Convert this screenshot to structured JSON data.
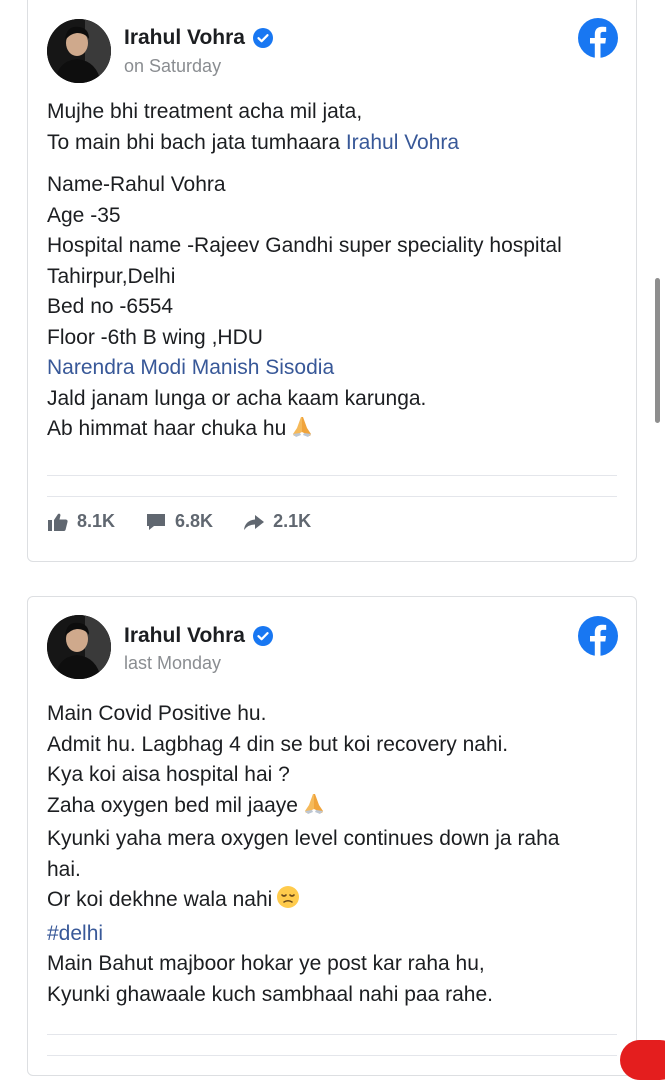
{
  "posts": [
    {
      "author": "Irahul Vohra",
      "timestamp": "on Saturday",
      "lines": {
        "l1": "Mujhe bhi treatment acha mil jata,",
        "l2_text": "To main bhi bach jata tumhaara ",
        "l2_link": "Irahul Vohra",
        "l3": "Name-Rahul Vohra",
        "l4": "Age -35",
        "l5": "Hospital name -Rajeev Gandhi super speciality hospital",
        "l6": "Tahirpur,Delhi",
        "l7": "Bed no -6554",
        "l8": "Floor -6th B wing ,HDU",
        "l9_link": "Narendra Modi Manish Sisodia",
        "l10": "Jald janam lunga or acha kaam karunga.",
        "l11": "Ab himmat haar chuka hu"
      },
      "stats": {
        "likes": "8.1K",
        "comments": "6.8K",
        "shares": "2.1K"
      }
    },
    {
      "author": "Irahul Vohra",
      "timestamp": "last Monday",
      "lines": {
        "l1": "Main Covid Positive hu.",
        "l2": "Admit hu. Lagbhag 4 din se but koi recovery nahi.",
        "l3": "Kya koi aisa hospital hai ?",
        "l4": "Zaha oxygen bed mil jaaye",
        "l5": "Kyunki yaha mera oxygen level continues down ja raha hai.",
        "l6": "Or koi dekhne wala nahi",
        "l7_link": "#delhi",
        "l8": "Main Bahut majboor hokar ye post kar raha hu,",
        "l9": "Kyunki ghawaale kuch sambhaal nahi paa rahe."
      }
    }
  ],
  "colors": {
    "facebook_blue": "#1877f2",
    "link": "#385898",
    "muted": "#8a8d91"
  },
  "icons": [
    "verified-badge-icon",
    "facebook-logo-icon",
    "like-icon",
    "comment-icon",
    "share-icon",
    "praying-hands-emoji",
    "sad-face-emoji"
  ]
}
